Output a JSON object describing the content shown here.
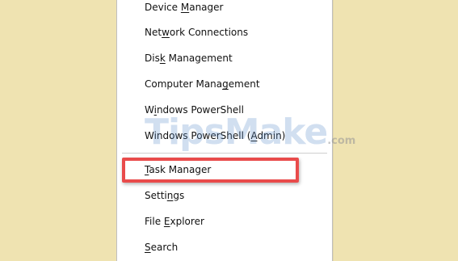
{
  "menu": {
    "items": [
      {
        "pre": "Device ",
        "key": "M",
        "post": "anager"
      },
      {
        "pre": "Net",
        "key": "w",
        "post": "ork Connections"
      },
      {
        "pre": "Dis",
        "key": "k",
        "post": " Management"
      },
      {
        "pre": "Computer Mana",
        "key": "g",
        "post": "ement"
      },
      {
        "pre": "W",
        "key": "i",
        "post": "ndows PowerShell"
      },
      {
        "pre": "Windows PowerShell (",
        "key": "A",
        "post": "dmin)"
      },
      {
        "pre": "",
        "key": "T",
        "post": "ask Manager"
      },
      {
        "pre": "Setti",
        "key": "n",
        "post": "gs"
      },
      {
        "pre": "File ",
        "key": "E",
        "post": "xplorer"
      },
      {
        "pre": "",
        "key": "S",
        "post": "earch"
      }
    ]
  },
  "highlight": {
    "target": "Task Manager",
    "color": "#e94b4b"
  },
  "watermark": {
    "text": "TipsMake",
    "suffix": ".com"
  }
}
